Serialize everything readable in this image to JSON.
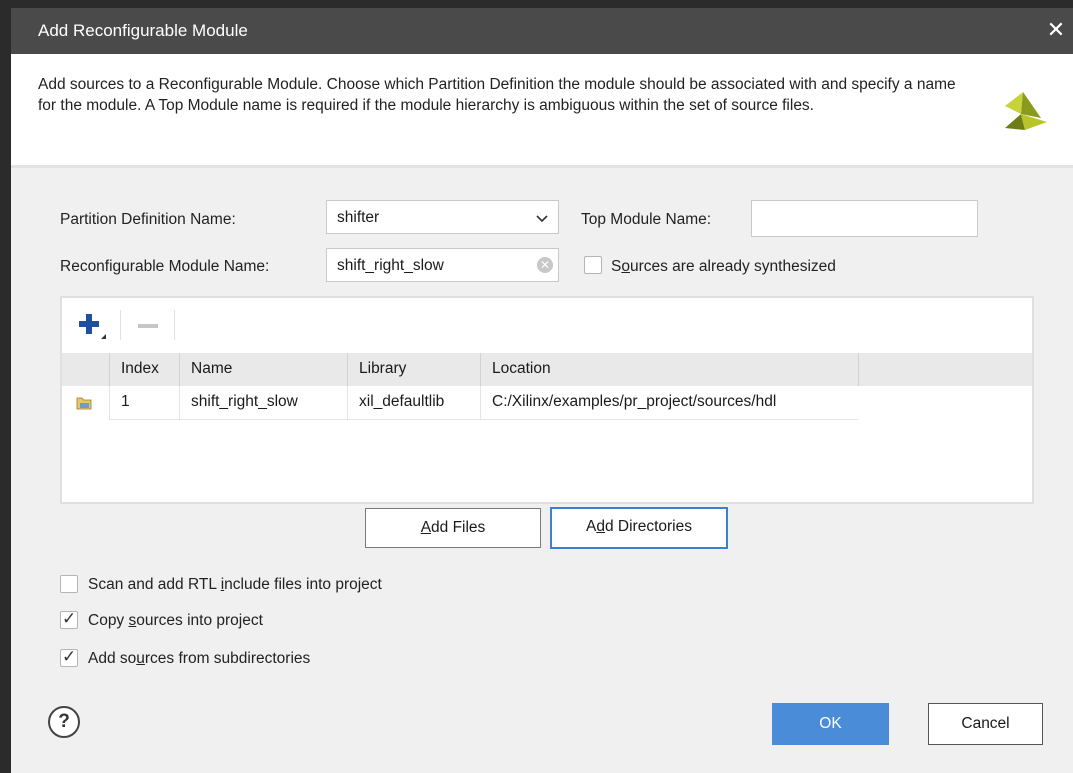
{
  "window": {
    "title": "Add Reconfigurable Module",
    "close_glyph": "✕"
  },
  "header": {
    "description": "Add sources to a Reconfigurable Module. Choose which Partition Definition the module should be associated with and specify a name for the module. A Top Module name is required if the module hierarchy is ambiguous within the set of source files.",
    "logo_icon": "vivado-logo-icon"
  },
  "form": {
    "partition_definition_label": "Partition Definition Name:",
    "partition_definition_value": "shifter",
    "top_module_label": "Top Module Name:",
    "top_module_value": "",
    "rm_name_label": "Reconfigurable Module Name:",
    "rm_name_value": "shift_right_slow",
    "synthesized_label_pre": "S",
    "synthesized_label_ul": "o",
    "synthesized_label_post": "urces are already synthesized",
    "synthesized_checked": false
  },
  "table": {
    "columns": [
      "Index",
      "Name",
      "Library",
      "Location"
    ],
    "rows": [
      {
        "index": "1",
        "name": "shift_right_slow",
        "library": "xil_defaultlib",
        "location": "C:/Xilinx/examples/pr_project/sources/hdl",
        "icon": "folder-icon"
      }
    ]
  },
  "buttons": {
    "add_files_ul": "A",
    "add_files_rest": "dd Files",
    "add_dirs_pre": "A",
    "add_dirs_ul": "d",
    "add_dirs_rest": "d Directories",
    "ok": "OK",
    "cancel": "Cancel",
    "help": "?"
  },
  "options": {
    "scan_pre": "Scan and add RTL ",
    "scan_ul": "i",
    "scan_post": "nclude files into project",
    "scan_checked": false,
    "copy_pre": "Copy ",
    "copy_ul": "s",
    "copy_post": "ources into project",
    "copy_checked": true,
    "subdir_pre": "Add so",
    "subdir_ul": "u",
    "subdir_post": "rces from subdirectories",
    "subdir_checked": true
  },
  "colors": {
    "accent": "#4a8cd8",
    "titlebar": "#4a4a4a",
    "focus_border": "#3f7fcf"
  }
}
